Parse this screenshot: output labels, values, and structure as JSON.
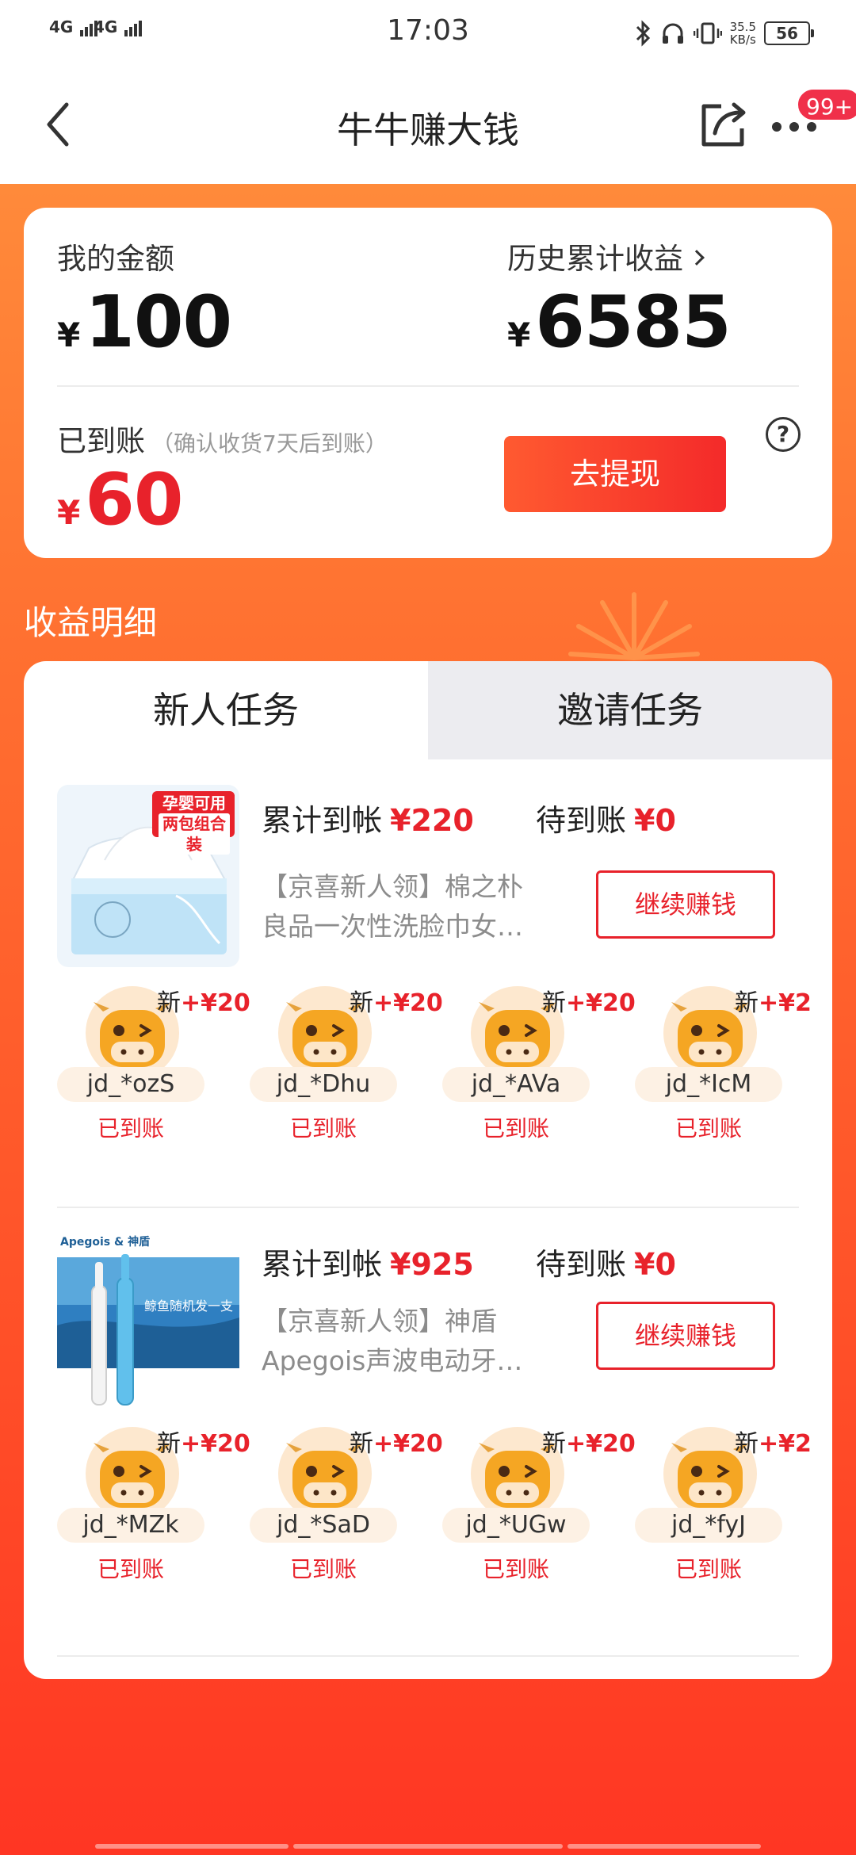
{
  "status_bar": {
    "signal_1": "4G",
    "signal_2": "4G",
    "time": "17:03",
    "speed_value": "35.5",
    "speed_unit": "KB/s",
    "battery": "56"
  },
  "nav": {
    "title": "牛牛赚大钱",
    "badge": "99+"
  },
  "summary": {
    "balance_label": "我的金额",
    "balance_currency": "¥",
    "balance_value": "100",
    "history_label": "历史累计收益",
    "history_currency": "¥",
    "history_value": "6585",
    "arrived_label": "已到账",
    "arrived_hint": "（确认收货7天后到账）",
    "arrived_currency": "¥",
    "arrived_value": "60",
    "withdraw_label": "去提现",
    "help_glyph": "?"
  },
  "section_title": "收益明细",
  "tabs": [
    {
      "label": "新人任务",
      "active": true
    },
    {
      "label": "邀请任务",
      "active": false
    }
  ],
  "tasks": [
    {
      "thumb_badge_1": "孕婴可用",
      "thumb_badge_2": "两包组合装",
      "total_label": "累计到帐",
      "total_value": "¥220",
      "pending_label": "待到账",
      "pending_value": "¥0",
      "description": "【京喜新人领】棉之朴良品一次性洗脸巾女…",
      "button": "继续赚钱",
      "users": [
        {
          "name": "jd_*ozS",
          "new_label": "新",
          "reward": "+¥20",
          "status": "已到账"
        },
        {
          "name": "jd_*Dhu",
          "new_label": "新",
          "reward": "+¥20",
          "status": "已到账"
        },
        {
          "name": "jd_*AVa",
          "new_label": "新",
          "reward": "+¥20",
          "status": "已到账"
        },
        {
          "name": "jd_*IcM",
          "new_label": "新",
          "reward": "+¥2",
          "status": "已到账"
        }
      ]
    },
    {
      "thumb_brand": "Apegois & 神盾",
      "thumb_caption": "鲸鱼随机发一支",
      "total_label": "累计到帐",
      "total_value": "¥925",
      "pending_label": "待到账",
      "pending_value": "¥0",
      "description": "【京喜新人领】神盾Apegois声波电动牙…",
      "button": "继续赚钱",
      "users": [
        {
          "name": "jd_*MZk",
          "new_label": "新",
          "reward": "+¥20",
          "status": "已到账"
        },
        {
          "name": "jd_*SaD",
          "new_label": "新",
          "reward": "+¥20",
          "status": "已到账"
        },
        {
          "name": "jd_*UGw",
          "new_label": "新",
          "reward": "+¥20",
          "status": "已到账"
        },
        {
          "name": "jd_*fyJ",
          "new_label": "新",
          "reward": "+¥2",
          "status": "已到账"
        }
      ]
    }
  ],
  "colors": {
    "accent_red": "#e8222b",
    "orange_top": "#ff8a3a",
    "orange_bottom": "#ff3623",
    "avatar_bg": "#fde8cf"
  }
}
